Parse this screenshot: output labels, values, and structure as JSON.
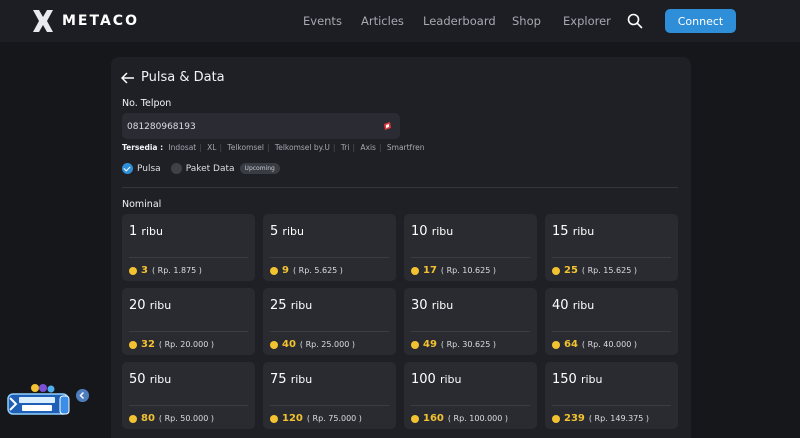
{
  "header": {
    "logo_text": "METACO",
    "nav": [
      "Events",
      "Articles",
      "Leaderboard",
      "Shop",
      "Explorer"
    ],
    "connect_label": "Connect"
  },
  "page": {
    "title": "Pulsa & Data",
    "phone_label": "No. Telpon",
    "phone_value": "081280968193",
    "available_label": "Tersedia :",
    "operators": [
      "Indosat",
      "XL",
      "Telkomsel",
      "Telkomsel by.U",
      "Tri",
      "Axis",
      "Smartfren"
    ],
    "option_pulsa": "Pulsa",
    "option_data": "Paket Data",
    "upcoming_badge": "Upcoming",
    "nominal_label": "Nominal",
    "coin_color": "#f2c230",
    "accent_color": "#2e8fd8"
  },
  "cards": [
    {
      "num": "1",
      "unit": "ribu",
      "coins": "3",
      "rp": "( Rp. 1.875 )"
    },
    {
      "num": "5",
      "unit": "ribu",
      "coins": "9",
      "rp": "( Rp. 5.625 )"
    },
    {
      "num": "10",
      "unit": "ribu",
      "coins": "17",
      "rp": "( Rp. 10.625 )"
    },
    {
      "num": "15",
      "unit": "ribu",
      "coins": "25",
      "rp": "( Rp. 15.625 )"
    },
    {
      "num": "20",
      "unit": "ribu",
      "coins": "32",
      "rp": "( Rp. 20.000 )"
    },
    {
      "num": "25",
      "unit": "ribu",
      "coins": "40",
      "rp": "( Rp. 25.000 )"
    },
    {
      "num": "30",
      "unit": "ribu",
      "coins": "49",
      "rp": "( Rp. 30.625 )"
    },
    {
      "num": "40",
      "unit": "ribu",
      "coins": "64",
      "rp": "( Rp. 40.000 )"
    },
    {
      "num": "50",
      "unit": "ribu",
      "coins": "80",
      "rp": "( Rp. 50.000 )"
    },
    {
      "num": "75",
      "unit": "ribu",
      "coins": "120",
      "rp": "( Rp. 75.000 )"
    },
    {
      "num": "100",
      "unit": "ribu",
      "coins": "160",
      "rp": "( Rp. 100.000 )"
    },
    {
      "num": "150",
      "unit": "ribu",
      "coins": "239",
      "rp": "( Rp. 149.375 )"
    }
  ],
  "icons": {
    "search": "search-icon",
    "back": "arrow-left-icon",
    "coin": "coin-icon"
  }
}
